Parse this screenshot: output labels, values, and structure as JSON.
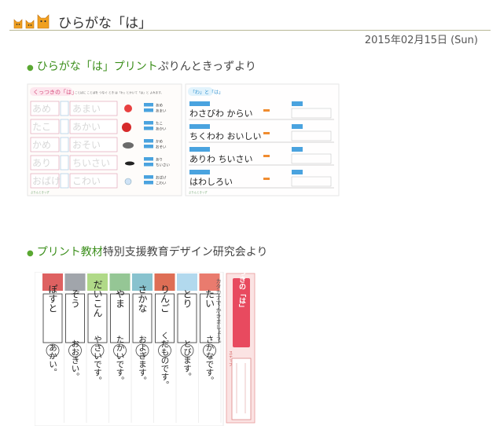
{
  "header": {
    "title": "ひらがな「は」",
    "date": "2015年02月15日 (Sun)"
  },
  "sections": [
    {
      "link_text": "ひらがな「は」プリント",
      "suffix": "ぷりんときっずより",
      "worksheet": {
        "left_header": "くっつきの「は」",
        "instruction": "ことばに ことばを つなぐ とき は「わ」とかいて「は」と よみます。",
        "grid_rows": [
          [
            "あめ",
            "あまい"
          ],
          [
            "たこ",
            "あかい"
          ],
          [
            "かめ",
            "おそい"
          ],
          [
            "あり",
            "ちいさい"
          ],
          [
            "おばけ",
            "こわい"
          ]
        ],
        "answer_pairs": [
          [
            "あめ",
            "あまい"
          ],
          [
            "たこ",
            "あかい"
          ],
          [
            "かめ",
            "おそい"
          ],
          [
            "あり",
            "ちいさい"
          ],
          [
            "おばけ",
            "こわい"
          ]
        ],
        "right_header": "「わ」と「は」",
        "right_sentences": [
          "わさびわ からい",
          "ちくわわ おいしい",
          "ありわ ちいさい",
          "はわしろい"
        ],
        "tag_label": "ぷりんときっず"
      }
    },
    {
      "link_text": "プリント教材",
      "suffix": "特別支援教育デザイン研究会より",
      "worksheet": {
        "words": [
          "ぽすと",
          "ぞう",
          "だいこん",
          "やま",
          "さかな",
          "りんご",
          "とり",
          "たい"
        ],
        "predicates": [
          "あかい。",
          "おおきい。",
          "やさいです。",
          "たかいです。",
          "およぎます。",
          "くだものです。",
          "とびます。",
          "さかなです。"
        ],
        "side_title": "くっつきの「は」",
        "instruction": "カタカナで かきましょう。",
        "step_label": "ステップ"
      }
    }
  ]
}
